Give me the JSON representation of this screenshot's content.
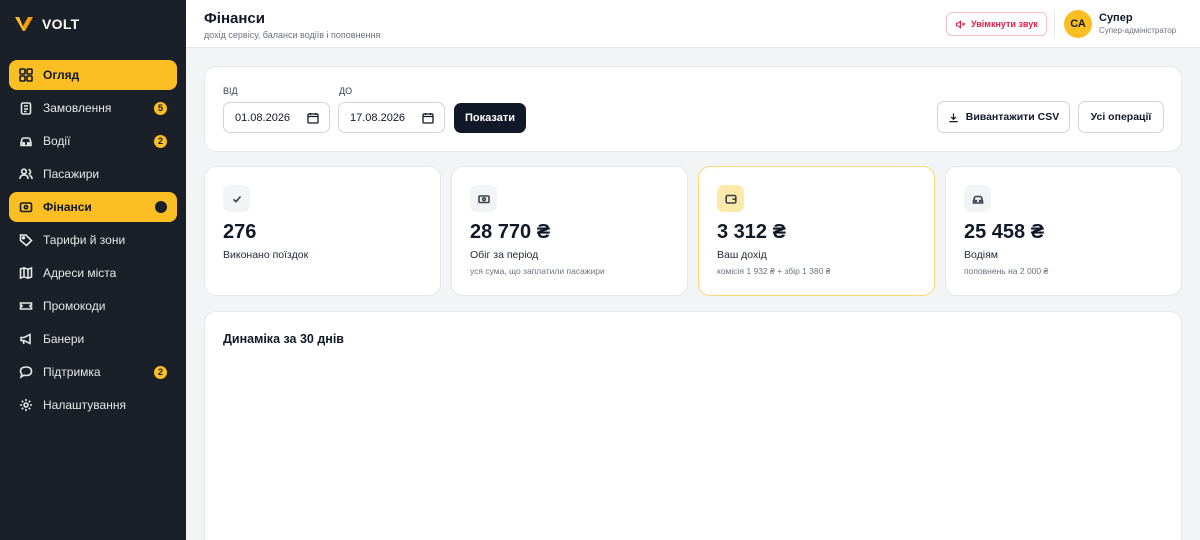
{
  "brand": {
    "name": "VOLT"
  },
  "sidebar": {
    "items": [
      {
        "label": "Огляд",
        "icon": "grid-icon",
        "active": true
      },
      {
        "label": "Замовлення",
        "icon": "clipboard-icon",
        "badge": "5"
      },
      {
        "label": "Водії",
        "icon": "car-icon",
        "badge": "2"
      },
      {
        "label": "Пасажири",
        "icon": "users-icon"
      },
      {
        "label": "Фінанси",
        "icon": "wallet-icon",
        "active": true
      },
      {
        "label": "Тарифи й зони",
        "icon": "tag-icon"
      },
      {
        "label": "Адреси міста",
        "icon": "map-icon"
      },
      {
        "label": "Промокоди",
        "icon": "ticket-icon"
      },
      {
        "label": "Банери",
        "icon": "megaphone-icon"
      },
      {
        "label": "Підтримка",
        "icon": "chat-icon",
        "badge": "2"
      },
      {
        "label": "Налаштування",
        "icon": "gear-icon"
      }
    ]
  },
  "header": {
    "title": "Фінанси",
    "subtitle": "дохід сервісу, баланси водіїв і поповнення",
    "sound_button": "Увімкнути звук",
    "user": {
      "initials": "СА",
      "name": "Супер",
      "role": "Супер-адміністратор"
    }
  },
  "filter": {
    "from_label": "ВІД",
    "from_value": "01.08.2026",
    "to_label": "ДО",
    "to_value": "17.08.2026",
    "show_button": "Показати",
    "csv_button": "Вивантажити CSV",
    "all_ops_button": "Усі операції"
  },
  "stats": [
    {
      "icon": "check-icon",
      "value": "276",
      "label": "Виконано поїздок",
      "note": ""
    },
    {
      "icon": "cash-icon",
      "value": "28 770 ₴",
      "label": "Обіг за період",
      "note": "уся сума, що заплатили пасажири"
    },
    {
      "icon": "wallet-icon",
      "value": "3 312 ₴",
      "label": "Ваш дохід",
      "note": "комісія 1 932 ₴ + збір 1 380 ₴",
      "highlight": true
    },
    {
      "icon": "car-icon",
      "value": "25 458 ₴",
      "label": "Водіям",
      "note": "поповнень на 2 000 ₴"
    }
  ],
  "chart": {
    "title": "Динаміка за 30 днів"
  },
  "colors": {
    "accent": "#fbbf24",
    "sidebar_bg": "#1b1f27",
    "danger": "#e11d48"
  }
}
